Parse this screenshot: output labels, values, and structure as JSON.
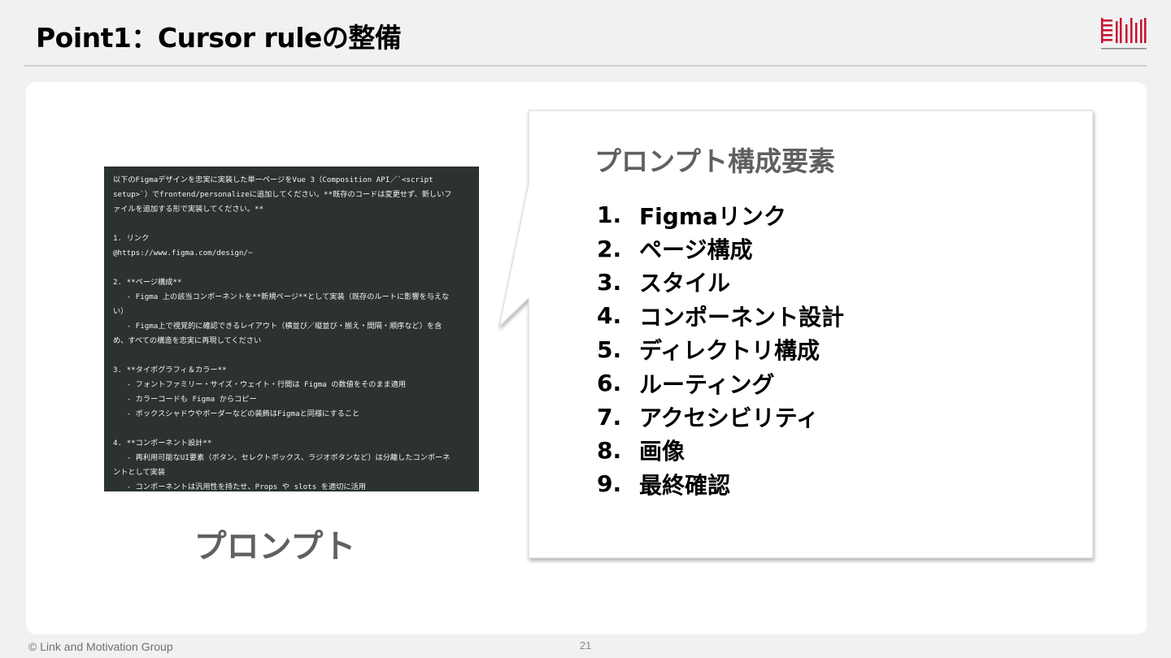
{
  "slide": {
    "title": "Point1：Cursor ruleの整備",
    "page_number": "21",
    "copyright": "© Link and Motivation Group"
  },
  "prompt_code": {
    "lines": [
      "以下のFigmaデザインを忠実に実装した単一ページをVue 3（Composition API／`<script",
      "setup>`）でfrontend/personalizeに追加してください。**既存のコードは変更せず、新しいフ",
      "ァイルを追加する形で実装してください。**",
      "",
      "1. リンク",
      "@https://www.figma.com/design/~",
      "",
      "2. **ページ構成**",
      "   - Figma 上の該当コンポーネントを**新規ページ**として実装（既存のルートに影響を与えな",
      "い）",
      "   - Figma上で視覚的に確認できるレイアウト（横並び／縦並び・揃え・間隔・順序など）を含",
      "め、すべての構造を忠実に再現してください",
      "",
      "3. **タイポグラフィ＆カラー**",
      "   - フォントファミリー・サイズ・ウェイト・行間は Figma の数値をそのまま適用",
      "   - カラーコードも Figma からコピー",
      "   - ボックスシャドウやボーダーなどの装飾はFigmaと同様にすること",
      "",
      "4. **コンポーネント設計**",
      "   - 再利用可能なUI要素（ボタン、セレクトボックス、ラジオボタンなど）は分離したコンポーネ",
      "ントとして実装",
      "   - コンポーネントは汎用性を持たせ、Props や slots を適切に活用"
    ],
    "caption": "プロンプト"
  },
  "elements_bubble": {
    "title": "プロンプト構成要素",
    "items": [
      {
        "num": "1.",
        "label": "Figmaリンク"
      },
      {
        "num": "2.",
        "label": "ページ構成"
      },
      {
        "num": "3.",
        "label": "スタイル"
      },
      {
        "num": "4.",
        "label": "コンポーネント設計"
      },
      {
        "num": "5.",
        "label": "ディレクトリ構成"
      },
      {
        "num": "6.",
        "label": "ルーティング"
      },
      {
        "num": "7.",
        "label": "アクセシビリティ"
      },
      {
        "num": "8.",
        "label": "画像"
      },
      {
        "num": "9.",
        "label": "最終確認"
      }
    ]
  },
  "colors": {
    "background": "#f1f1f1",
    "panel": "#ffffff",
    "code_background": "#2b3231",
    "logo_red": "#c8102e",
    "muted_heading": "#606060"
  }
}
